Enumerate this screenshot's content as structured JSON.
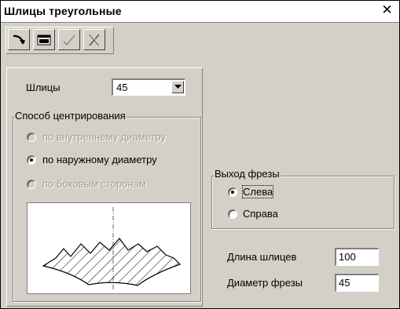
{
  "window": {
    "title": "Шлицы треугольные",
    "close_icon": "close-icon"
  },
  "toolbar": {
    "buttons": [
      {
        "icon": "pointer-curve-icon"
      },
      {
        "icon": "table-icon"
      },
      {
        "icon": "checkmark-icon"
      },
      {
        "icon": "cancel-x-icon"
      }
    ]
  },
  "splines": {
    "label": "Шлицы",
    "value": "45"
  },
  "centering": {
    "legend": "Способ центрирования",
    "options": [
      {
        "label": "по внутреннему диаметру",
        "selected": false,
        "enabled": false
      },
      {
        "label": "по наружному диаметру",
        "selected": true,
        "enabled": true
      },
      {
        "label": "по боковым сторонам",
        "selected": false,
        "enabled": false
      }
    ]
  },
  "cutter_exit": {
    "legend": "Выход фрезы",
    "options": [
      {
        "label": "Слева",
        "selected": true
      },
      {
        "label": "Справа",
        "selected": false
      }
    ]
  },
  "fields": {
    "length_label": "Длина шлицев",
    "length_value": "100",
    "diameter_label": "Диаметр фрезы",
    "diameter_value": "45"
  },
  "colors": {
    "face": "#d4d0c8",
    "shadow": "#808080",
    "highlight": "#ffffff",
    "disabled_text": "#a09c94"
  }
}
